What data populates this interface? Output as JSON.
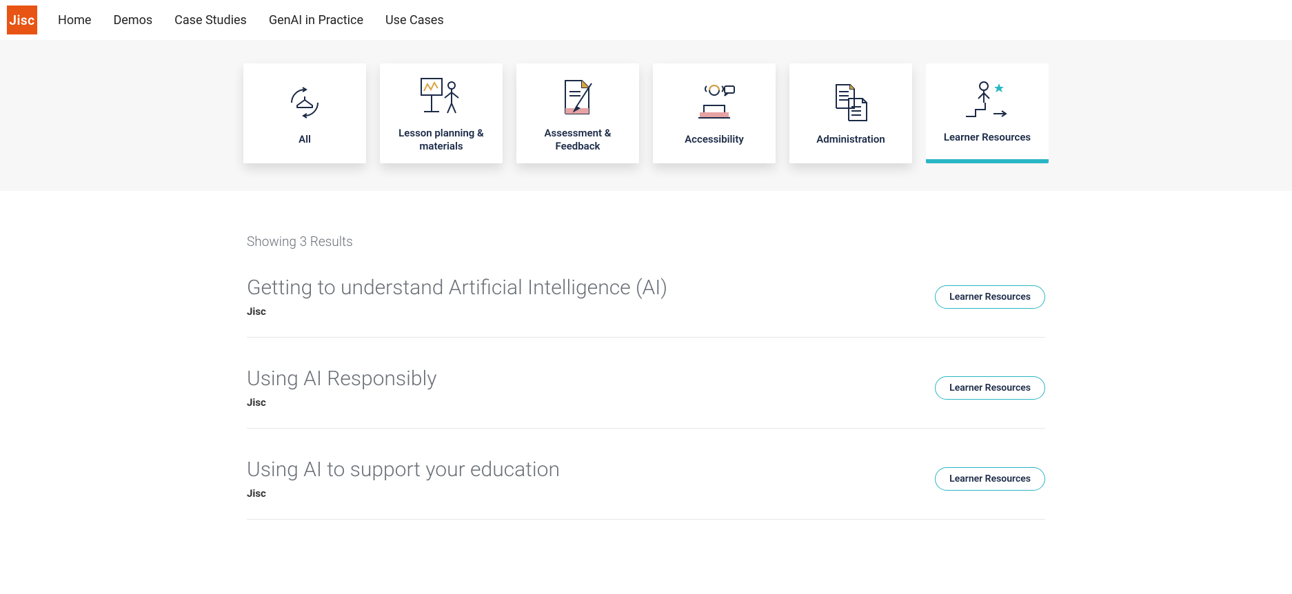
{
  "logo_text": "Jisc",
  "nav": {
    "items": [
      {
        "label": "Home"
      },
      {
        "label": "Demos"
      },
      {
        "label": "Case Studies"
      },
      {
        "label": "GenAI in Practice"
      },
      {
        "label": "Use Cases"
      }
    ]
  },
  "filters": [
    {
      "label": "All",
      "icon": "all-icon",
      "active": false
    },
    {
      "label": "Lesson planning & materials",
      "icon": "lesson-icon",
      "active": false
    },
    {
      "label": "Assessment & Feedback",
      "icon": "assessment-icon",
      "active": false
    },
    {
      "label": "Accessibility",
      "icon": "accessibility-icon",
      "active": false
    },
    {
      "label": "Administration",
      "icon": "administration-icon",
      "active": false
    },
    {
      "label": "Learner Resources",
      "icon": "learner-icon",
      "active": true
    }
  ],
  "results_count_text": "Showing 3 Results",
  "results": [
    {
      "title": "Getting to understand Artificial Intelligence (AI)",
      "source": "Jisc",
      "tag": "Learner Resources"
    },
    {
      "title": "Using AI Responsibly",
      "source": "Jisc",
      "tag": "Learner Resources"
    },
    {
      "title": "Using AI to support your education",
      "source": "Jisc",
      "tag": "Learner Resources"
    }
  ]
}
